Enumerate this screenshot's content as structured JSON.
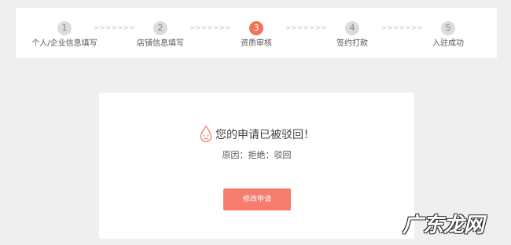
{
  "steps": [
    {
      "number": "1",
      "label": "个人/企业信息填写"
    },
    {
      "number": "2",
      "label": "店铺信息填写"
    },
    {
      "number": "3",
      "label": "资质审核"
    },
    {
      "number": "4",
      "label": "签约打款"
    },
    {
      "number": "5",
      "label": "入驻成功"
    }
  ],
  "step_separator": ">>>>>>>",
  "active_step": 3,
  "result": {
    "icon": "drop-icon",
    "title": "您的申请已被驳回！",
    "reason": "原因：拒绝：驳回"
  },
  "modify_button_label": "修改申请",
  "watermark_text": "广东龙网",
  "colors": {
    "accent": "#f0735a",
    "button": "#f47d6f",
    "inactive_step": "#dcdcdc",
    "background": "#efefef"
  }
}
